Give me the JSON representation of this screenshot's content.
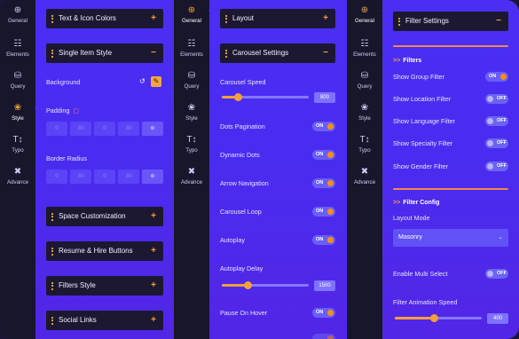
{
  "nav": [
    {
      "icon": "⊕",
      "label": "General"
    },
    {
      "icon": "☷",
      "label": "Elements"
    },
    {
      "icon": "⛁",
      "label": "Query"
    },
    {
      "icon": "❀",
      "label": "Style"
    },
    {
      "icon": "T↕",
      "label": "Typo"
    },
    {
      "icon": "✖",
      "label": "Advance"
    }
  ],
  "panel1": {
    "text_icon_colors": "Text & Icon Colors",
    "single_item_style": "Single Item Style",
    "background_label": "Background",
    "reset_icon": "↺",
    "pencil_icon": "✎",
    "padding_label": "Padding",
    "monitor_icon": "▢",
    "padding_values": [
      "0",
      "30",
      "0",
      "30"
    ],
    "link_icon": "⊕",
    "border_radius_label": "Border Radius",
    "border_values": [
      "0",
      "30",
      "0",
      "30"
    ],
    "space_customization": "Space Customization",
    "resume_hire": "Resume & Hire Buttons",
    "filters_style": "Filters Style",
    "social_links": "Social Links",
    "plus": "+",
    "minus": "−"
  },
  "panel2": {
    "layout": "Layout",
    "carousel_settings": "Carousel Settings",
    "carousel_speed_label": "Carousel Speed",
    "carousel_speed_value": "800",
    "carousel_speed_fraction": 0.18,
    "dots_pagination": "Dots Pagination",
    "dynamic_dots": "Dynamic Dots",
    "arrow_navigation": "Arrow Navigation",
    "carousel_loop": "Carousel Loop",
    "autoplay": "Autoplay",
    "autoplay_delay_label": "Autoplay Delay",
    "autoplay_delay_value": "1500",
    "autoplay_delay_fraction": 0.3,
    "pause_on_hover": "Pause On Hover",
    "on": "ON"
  },
  "panel3": {
    "filter_settings": "Filter Settings",
    "filters_section": "Filters",
    "show_group_filter": "Show Group Filter",
    "show_location_filter": "Show Location Filter",
    "show_language_filter": "Show Language Filter",
    "show_specialty_filter": "Show Specialty Filter",
    "show_gender_filter": "Show Gender Filter",
    "filter_config_section": "Filter Config",
    "layout_mode_label": "Layout Mode",
    "layout_mode_value": "Masonry",
    "enable_multi_select": "Enable Multi Select",
    "filter_animation_speed": "Filter Animation Speed",
    "filter_animation_value": "400",
    "filter_animation_fraction": 0.45,
    "on": "ON",
    "off": "OFF",
    "chevron": ">>"
  },
  "colors": {
    "accent": "#f5a03a",
    "rail": "#17162a",
    "content": "#4a2ef4"
  }
}
